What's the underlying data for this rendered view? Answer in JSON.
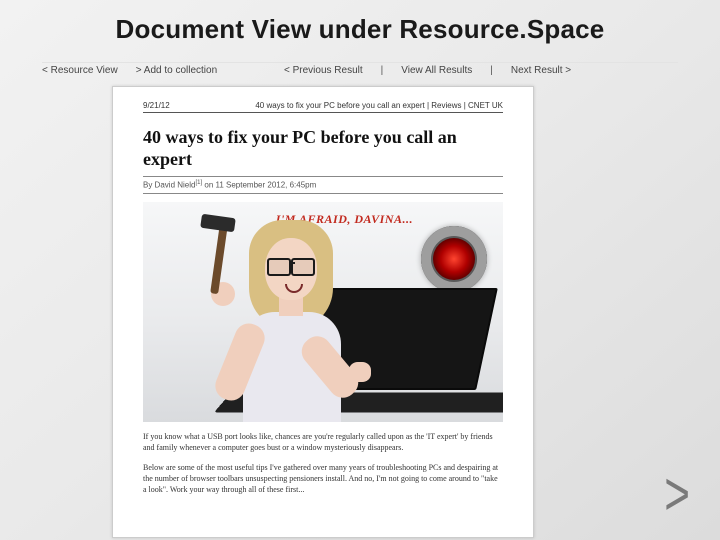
{
  "slide": {
    "title": "Document View under Resource.Space"
  },
  "nav": {
    "back": "< Resource View",
    "add": "> Add to collection",
    "prev": "< Previous Result",
    "all": "View All Results",
    "next": "Next Result >"
  },
  "doc": {
    "print_date": "9/21/12",
    "print_header": "40 ways to fix your PC before you call an expert | Reviews | CNET UK",
    "title": "40 ways to fix your PC before you call an expert",
    "byline_pre": "By David Nield",
    "byline_sup": "[1]",
    "byline_post": " on 11 September 2012, 6:45pm",
    "speech": "I'M AFRAID, DAVINA...",
    "para1": "If you know what a USB port looks like, chances are you're regularly called upon as the 'IT expert' by friends and family whenever a computer goes bust or a window mysteriously disappears.",
    "para2": "Below are some of the most useful tips I've gathered over many years of troubleshooting PCs and despairing at the number of browser toolbars unsuspecting pensioners install. And no, I'm not going to come around to \"take a look\". Work your way through all of these first..."
  },
  "controls": {
    "next_arrow": ">"
  }
}
